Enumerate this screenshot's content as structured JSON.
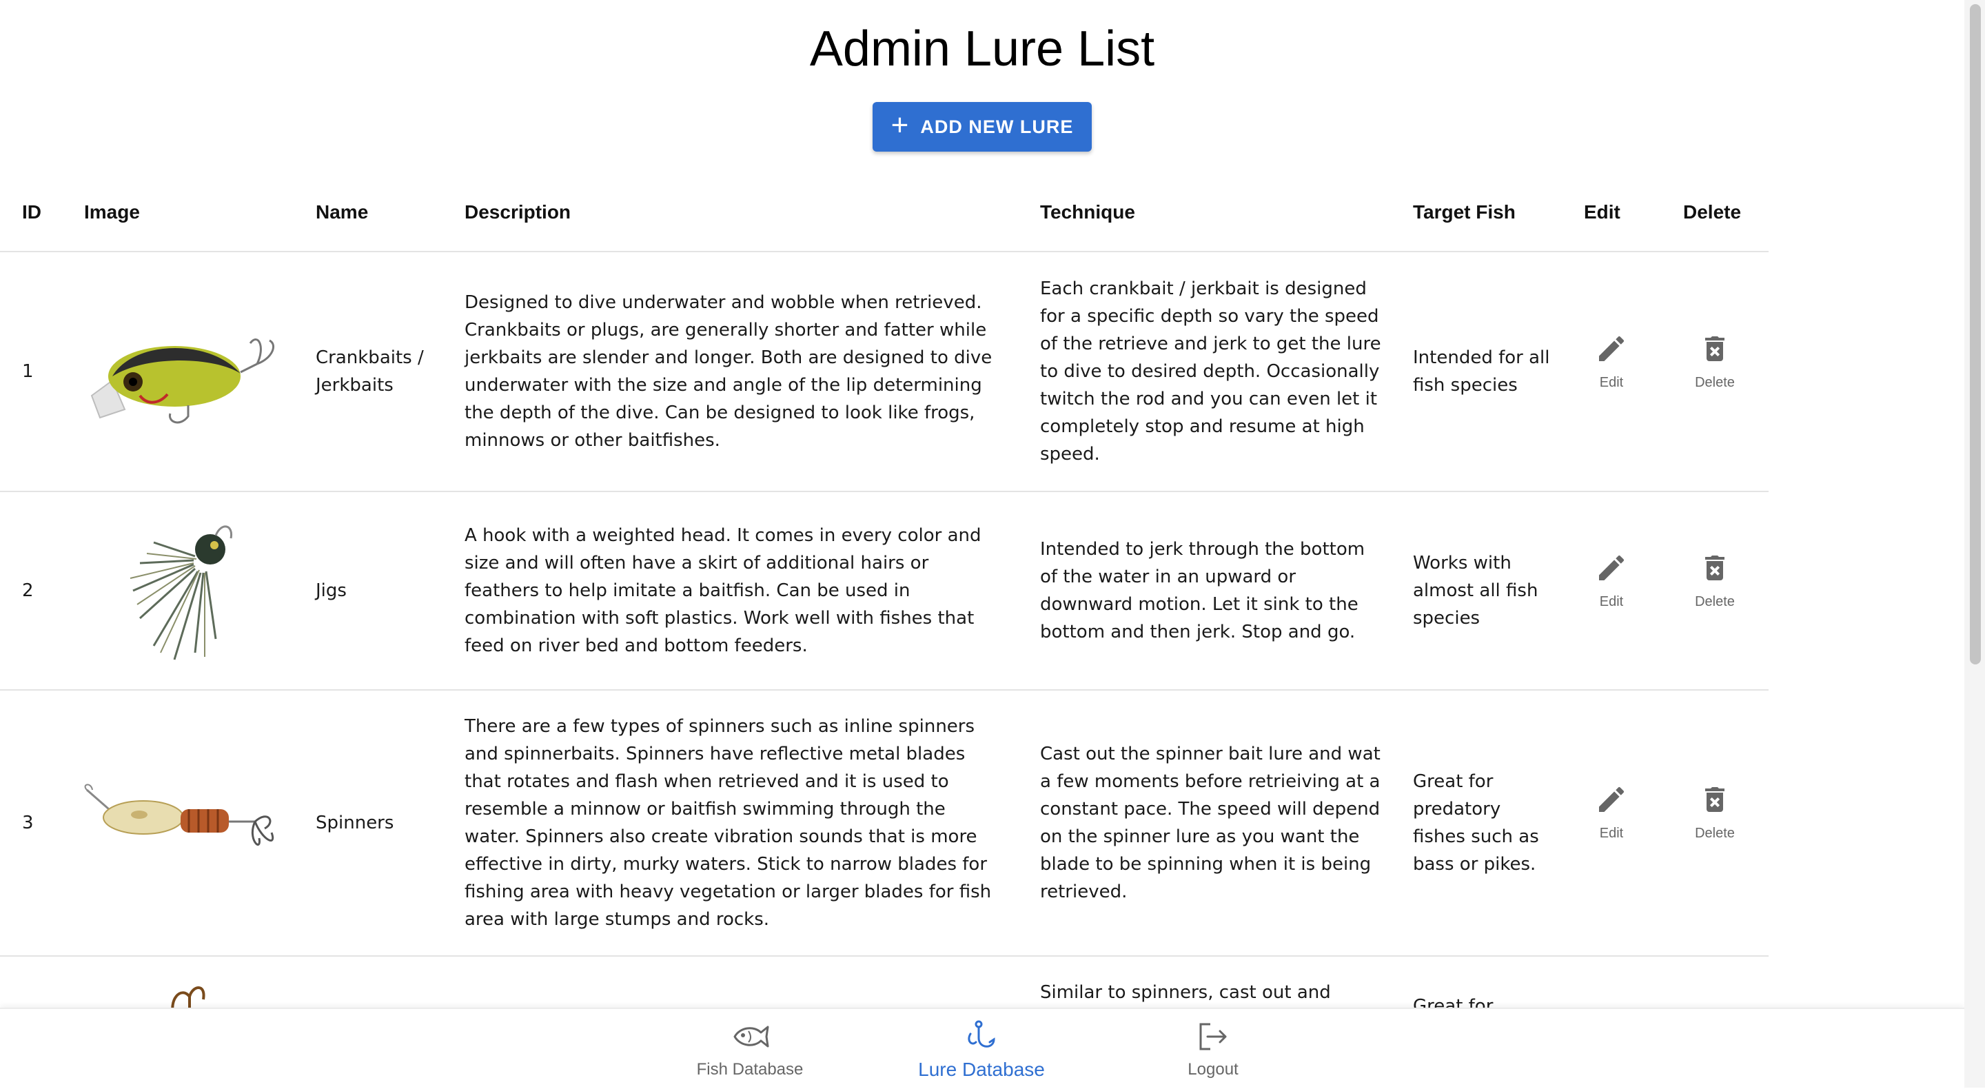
{
  "page": {
    "title": "Admin Lure List"
  },
  "actions": {
    "add_label": "ADD NEW LURE",
    "add_icon": "plus-icon"
  },
  "table": {
    "headers": [
      "ID",
      "Image",
      "Name",
      "Description",
      "Technique",
      "Target Fish",
      "Edit",
      "Delete"
    ],
    "edit_label": "Edit",
    "delete_label": "Delete",
    "rows": [
      {
        "id": "1",
        "image": "crankbait-lure",
        "name": "Crankbaits / Jerkbaits",
        "description": "Designed to dive underwater and wobble when retrieved. Crankbaits or plugs, are generally shorter and fatter while jerkbaits are slender and longer. Both are designed to dive underwater with the size and angle of the lip determining the depth of the dive. Can be designed to look like frogs, minnows or other baitfishes.",
        "technique": "Each crankbait / jerkbait is designed for a specific depth so vary the speed of the retrieve and jerk to get the lure to dive to desired depth. Occasionally twitch the rod and you can even let it completely stop and resume at high speed.",
        "target": "Intended for all fish species"
      },
      {
        "id": "2",
        "image": "jig-lure",
        "name": "Jigs",
        "description": "A hook with a weighted head. It comes in every color and size and will often have a skirt of additional hairs or feathers to help imitate a baitfish. Can be used in combination with soft plastics. Work well with fishes that feed on river bed and bottom feeders.",
        "technique": "Intended to jerk through the bottom of the water in an upward or downward motion. Let it sink to the bottom and then jerk. Stop and go.",
        "target": "Works with almost all fish species"
      },
      {
        "id": "3",
        "image": "spinner-lure",
        "name": "Spinners",
        "description": "There are a few types of spinners such as inline spinners and spinnerbaits. Spinners have reflective metal blades that rotates and flash when retrieved and it is used to resemble a minnow or baitfish swimming through the water. Spinners also create vibration sounds that is more effective in dirty, murky waters. Stick to narrow blades for fishing area with heavy vegetation or larger blades for fish area with large stumps and rocks.",
        "technique": "Cast out the spinner bait lure and wat a few moments before retrieiving at a constant pace. The speed will depend on the spinner lure as you want the blade to be spinning when it is being retrieved.",
        "target": "Great for predatory fishes such as bass or pikes."
      },
      {
        "id": "",
        "image": "hook-lure",
        "name": "",
        "description": "",
        "technique": "Similar to spinners, cast out and",
        "target": "Great for"
      }
    ]
  },
  "bottom_nav": {
    "items": [
      {
        "label": "Fish Database",
        "icon": "fish-icon"
      },
      {
        "label": "Lure Database",
        "icon": "hook-icon",
        "active": true
      },
      {
        "label": "Logout",
        "icon": "logout-icon"
      }
    ],
    "active_color": "#2f6fd1"
  },
  "colors": {
    "accent": "#2f6fd1",
    "divider": "#e3e3e3"
  }
}
